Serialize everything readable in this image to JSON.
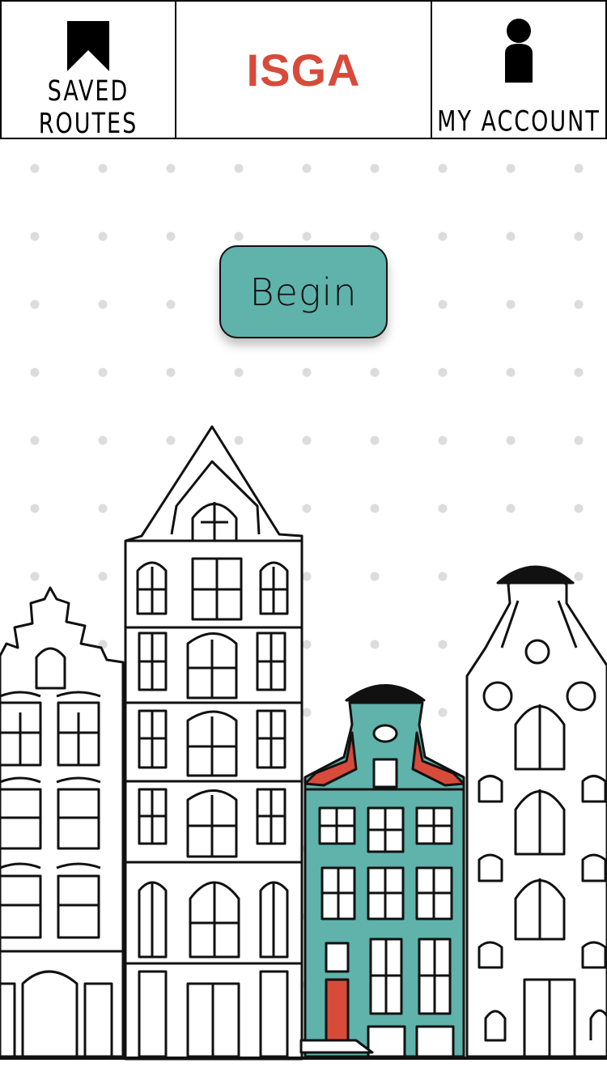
{
  "header": {
    "saved_routes_label": "SAVED ROUTES",
    "brand": "ISGA",
    "account_label": "MY ACCOUNT",
    "icons": {
      "saved": "bookmark-icon",
      "account": "user-icon"
    }
  },
  "main": {
    "begin_label": "Begin"
  },
  "colors": {
    "brand": "#d84a3a",
    "button": "#5fb3ab",
    "house_teal": "#5fb3ab",
    "house_red": "#d84a3a"
  }
}
